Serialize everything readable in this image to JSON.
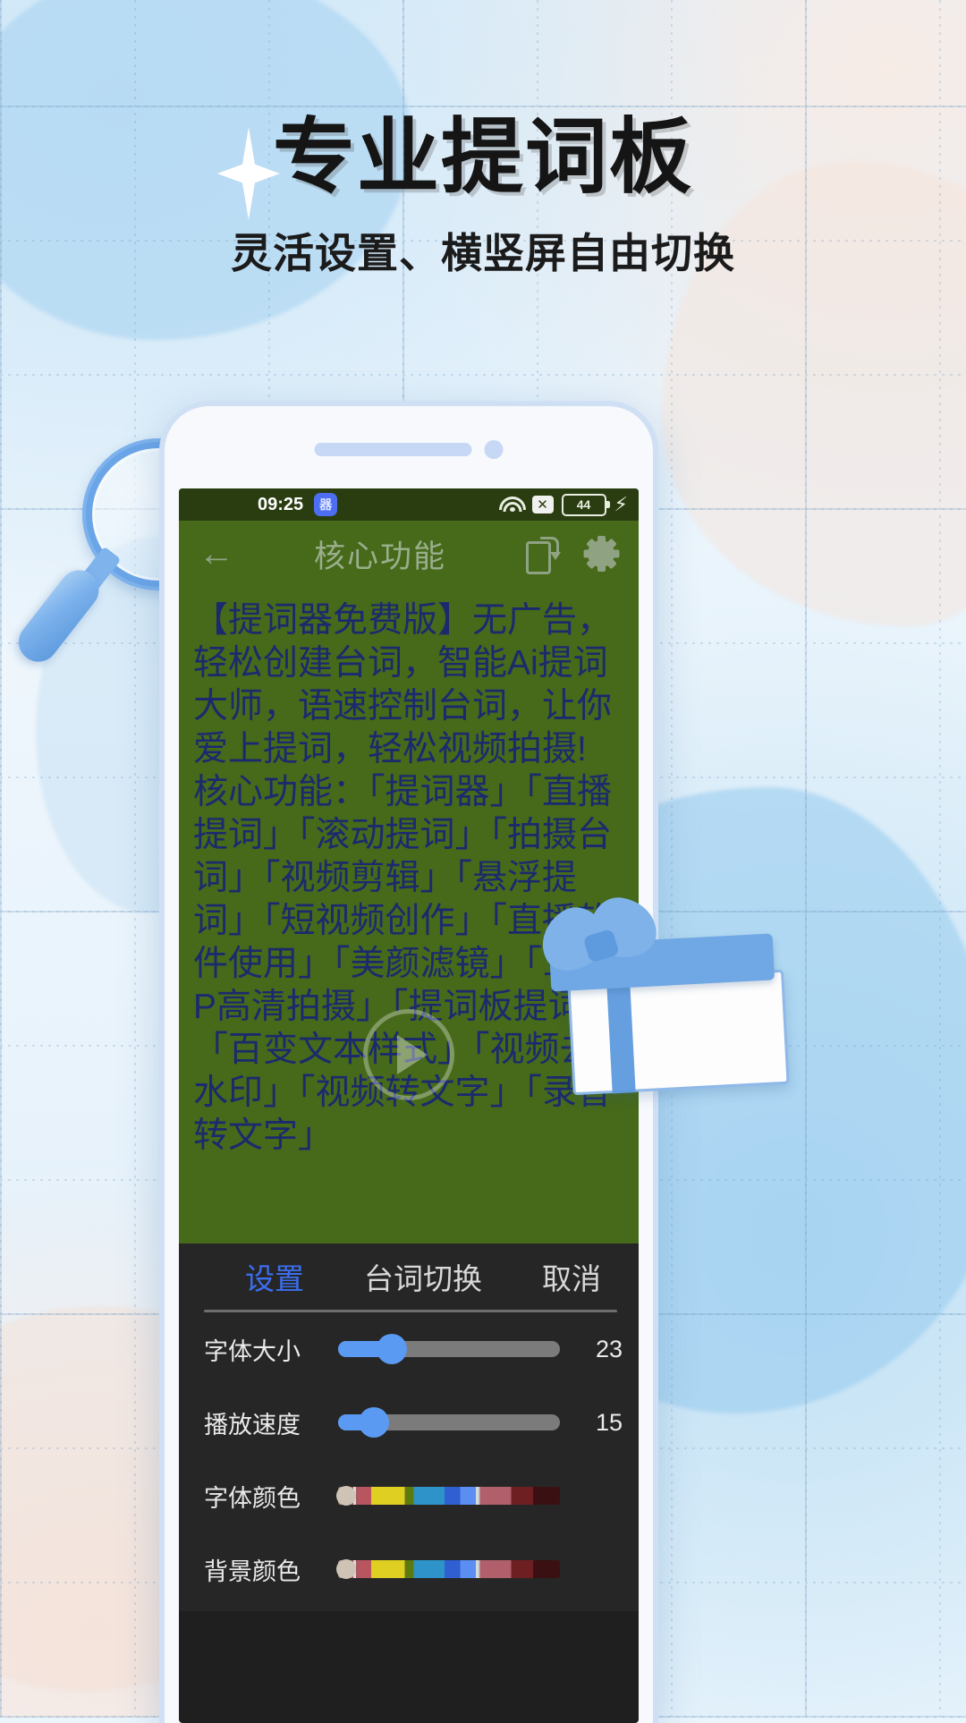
{
  "poster": {
    "title": "专业提词板",
    "subtitle": "灵活设置、横竖屏自由切换",
    "accent_blue": "#5a9af2",
    "prompter_bg": "#46691a",
    "prompter_text_color": "#1b2a6e"
  },
  "phone": {
    "statusbar": {
      "time": "09:25",
      "app_badge": "器",
      "wifi_icon": "wifi-icon",
      "no_signal_icon": "x-icon",
      "battery_level": "44",
      "charging_icon": "bolt-icon"
    },
    "appbar": {
      "back_icon": "back-arrow-icon",
      "title": "核心功能",
      "rotate_icon": "rotate-screen-icon",
      "settings_icon": "gear-icon"
    },
    "prompter": {
      "text": "【提词器免费版】无广告，轻松创建台词，智能Ai提词大师，语速控制台词，让你爱上提词，轻松视频拍摄!\n核心功能：「提词器」「直播提词」「滚动提词」「拍摄台词」「视频剪辑」「悬浮提词」「短视频创作」「直播软件使用」「美颜滤镜」「1080P高清拍摄」「提词板提词」「百变文本样式」「视频去水印」「视频转文字」「录音转文字」",
      "play_icon": "play-icon"
    },
    "panel": {
      "tabs": [
        {
          "label": "设置",
          "active": true
        },
        {
          "label": "台词切换",
          "active": false
        },
        {
          "label": "取消",
          "active": false
        }
      ],
      "rows": [
        {
          "label": "字体大小",
          "type": "slider",
          "value": "23",
          "percent": 24
        },
        {
          "label": "播放速度",
          "type": "slider",
          "value": "15",
          "percent": 16
        },
        {
          "label": "字体颜色",
          "type": "colorbar",
          "value": "",
          "percent": 2
        },
        {
          "label": "背景颜色",
          "type": "colorbar",
          "value": "",
          "percent": 2
        }
      ]
    }
  },
  "decorations": {
    "magnifier": "magnifier-icon",
    "gift": "gift-box-icon",
    "sparkle": "sparkle-icon"
  }
}
